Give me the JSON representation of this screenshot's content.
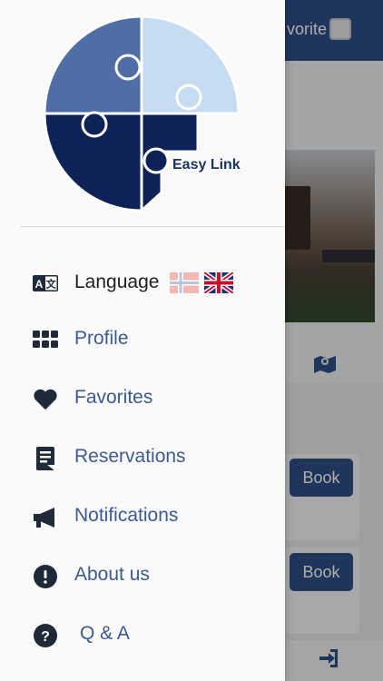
{
  "background": {
    "header_favorite_label": "vorite",
    "book_buttons": [
      "Book",
      "Book"
    ]
  },
  "drawer": {
    "logo_text": "Easy Link",
    "menu": [
      {
        "label": "Language",
        "icon": "translate-icon"
      },
      {
        "label": "Profile",
        "icon": "grid-icon"
      },
      {
        "label": "Favorites",
        "icon": "heart-icon"
      },
      {
        "label": "Reservations",
        "icon": "document-icon"
      },
      {
        "label": "Notifications",
        "icon": "megaphone-icon"
      },
      {
        "label": "About us",
        "icon": "exclamation-circle-icon"
      },
      {
        "label": "Q & A",
        "icon": "question-circle-icon"
      }
    ],
    "languages": [
      "Norwegian",
      "English"
    ]
  },
  "colors": {
    "primary": "#2f4e86",
    "drawer_text": "#3c5b90",
    "icon_dark": "#1f2a38"
  }
}
